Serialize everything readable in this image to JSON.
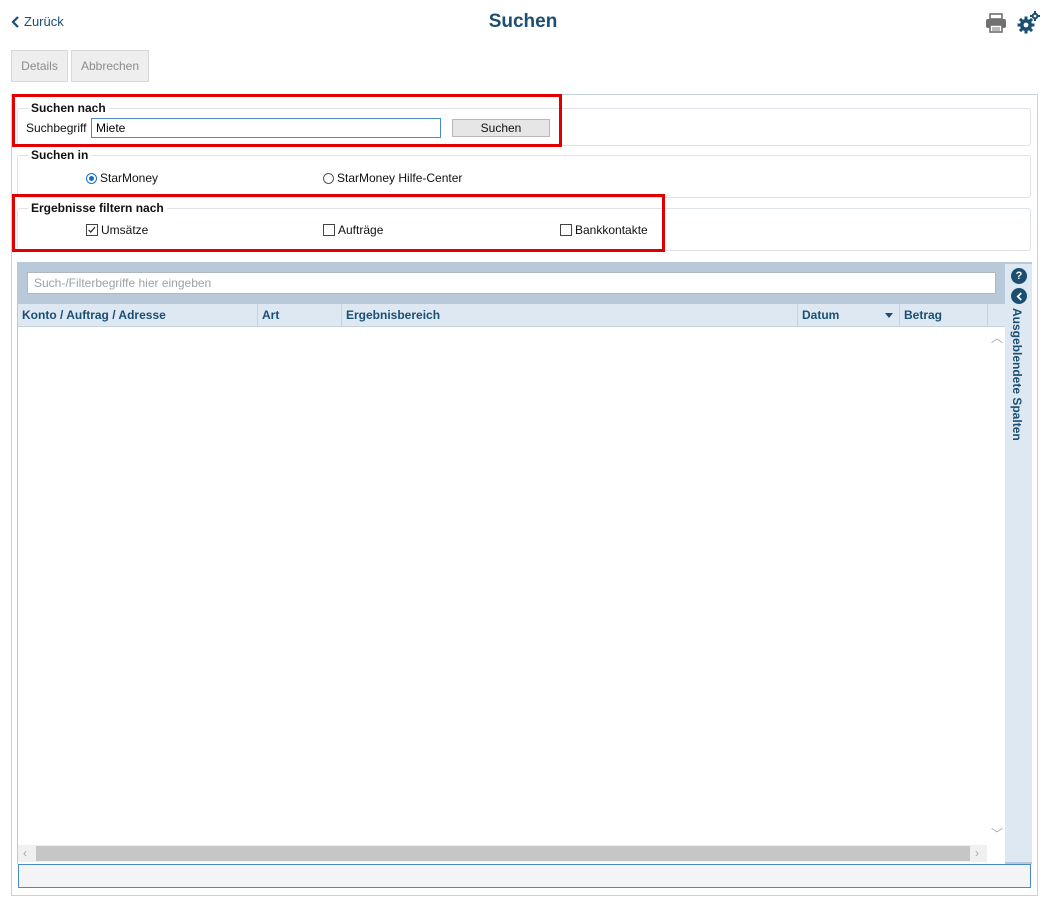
{
  "header": {
    "back_label": "Zurück",
    "title": "Suchen"
  },
  "toolbar": {
    "details_label": "Details",
    "cancel_label": "Abbrechen"
  },
  "search_for": {
    "legend": "Suchen nach",
    "term_label": "Suchbegriff",
    "term_value": "Miete",
    "search_button": "Suchen"
  },
  "search_in": {
    "legend": "Suchen in",
    "options": [
      {
        "label": "StarMoney",
        "selected": true
      },
      {
        "label": "StarMoney Hilfe-Center",
        "selected": false
      }
    ]
  },
  "filter_by": {
    "legend": "Ergebnisse filtern nach",
    "options": [
      {
        "label": "Umsätze",
        "checked": true
      },
      {
        "label": "Aufträge",
        "checked": false
      },
      {
        "label": "Bankkontakte",
        "checked": false
      }
    ]
  },
  "results": {
    "filter_placeholder": "Such-/Filterbegriffe hier eingeben",
    "columns": [
      "Konto / Auftrag / Adresse",
      "Art",
      "Ergebnisbereich",
      "Datum",
      "Betrag"
    ],
    "sort_column": "Datum",
    "rows": []
  },
  "side_panel": {
    "hidden_columns_label": "Ausgeblendete Spalten"
  },
  "colors": {
    "accent": "#1b4f72",
    "highlight": "#e00000",
    "header_bg": "#dde8f3"
  }
}
